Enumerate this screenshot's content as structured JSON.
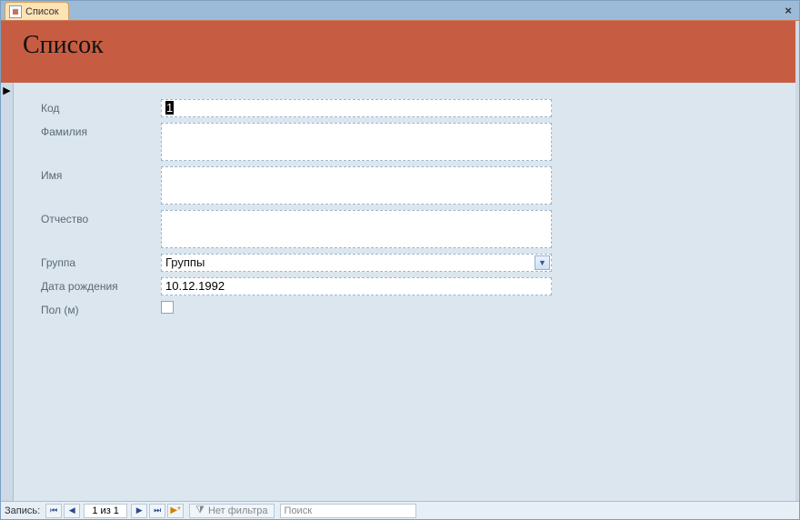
{
  "tab": {
    "title": "Список"
  },
  "header": {
    "title": "Список"
  },
  "fields": {
    "code": {
      "label": "Код",
      "value": "1"
    },
    "surname": {
      "label": "Фамилия",
      "value": ""
    },
    "name": {
      "label": "Имя",
      "value": ""
    },
    "patronymic": {
      "label": "Отчество",
      "value": ""
    },
    "group": {
      "label": "Группа",
      "selected": "Группы"
    },
    "birthdate": {
      "label": "Дата рождения",
      "value": "10.12.1992"
    },
    "sex_m": {
      "label": "Пол (м)",
      "checked": false
    }
  },
  "recnav": {
    "label": "Запись:",
    "position": "1 из 1",
    "filter_label": "Нет фильтра",
    "search_placeholder": "Поиск"
  }
}
